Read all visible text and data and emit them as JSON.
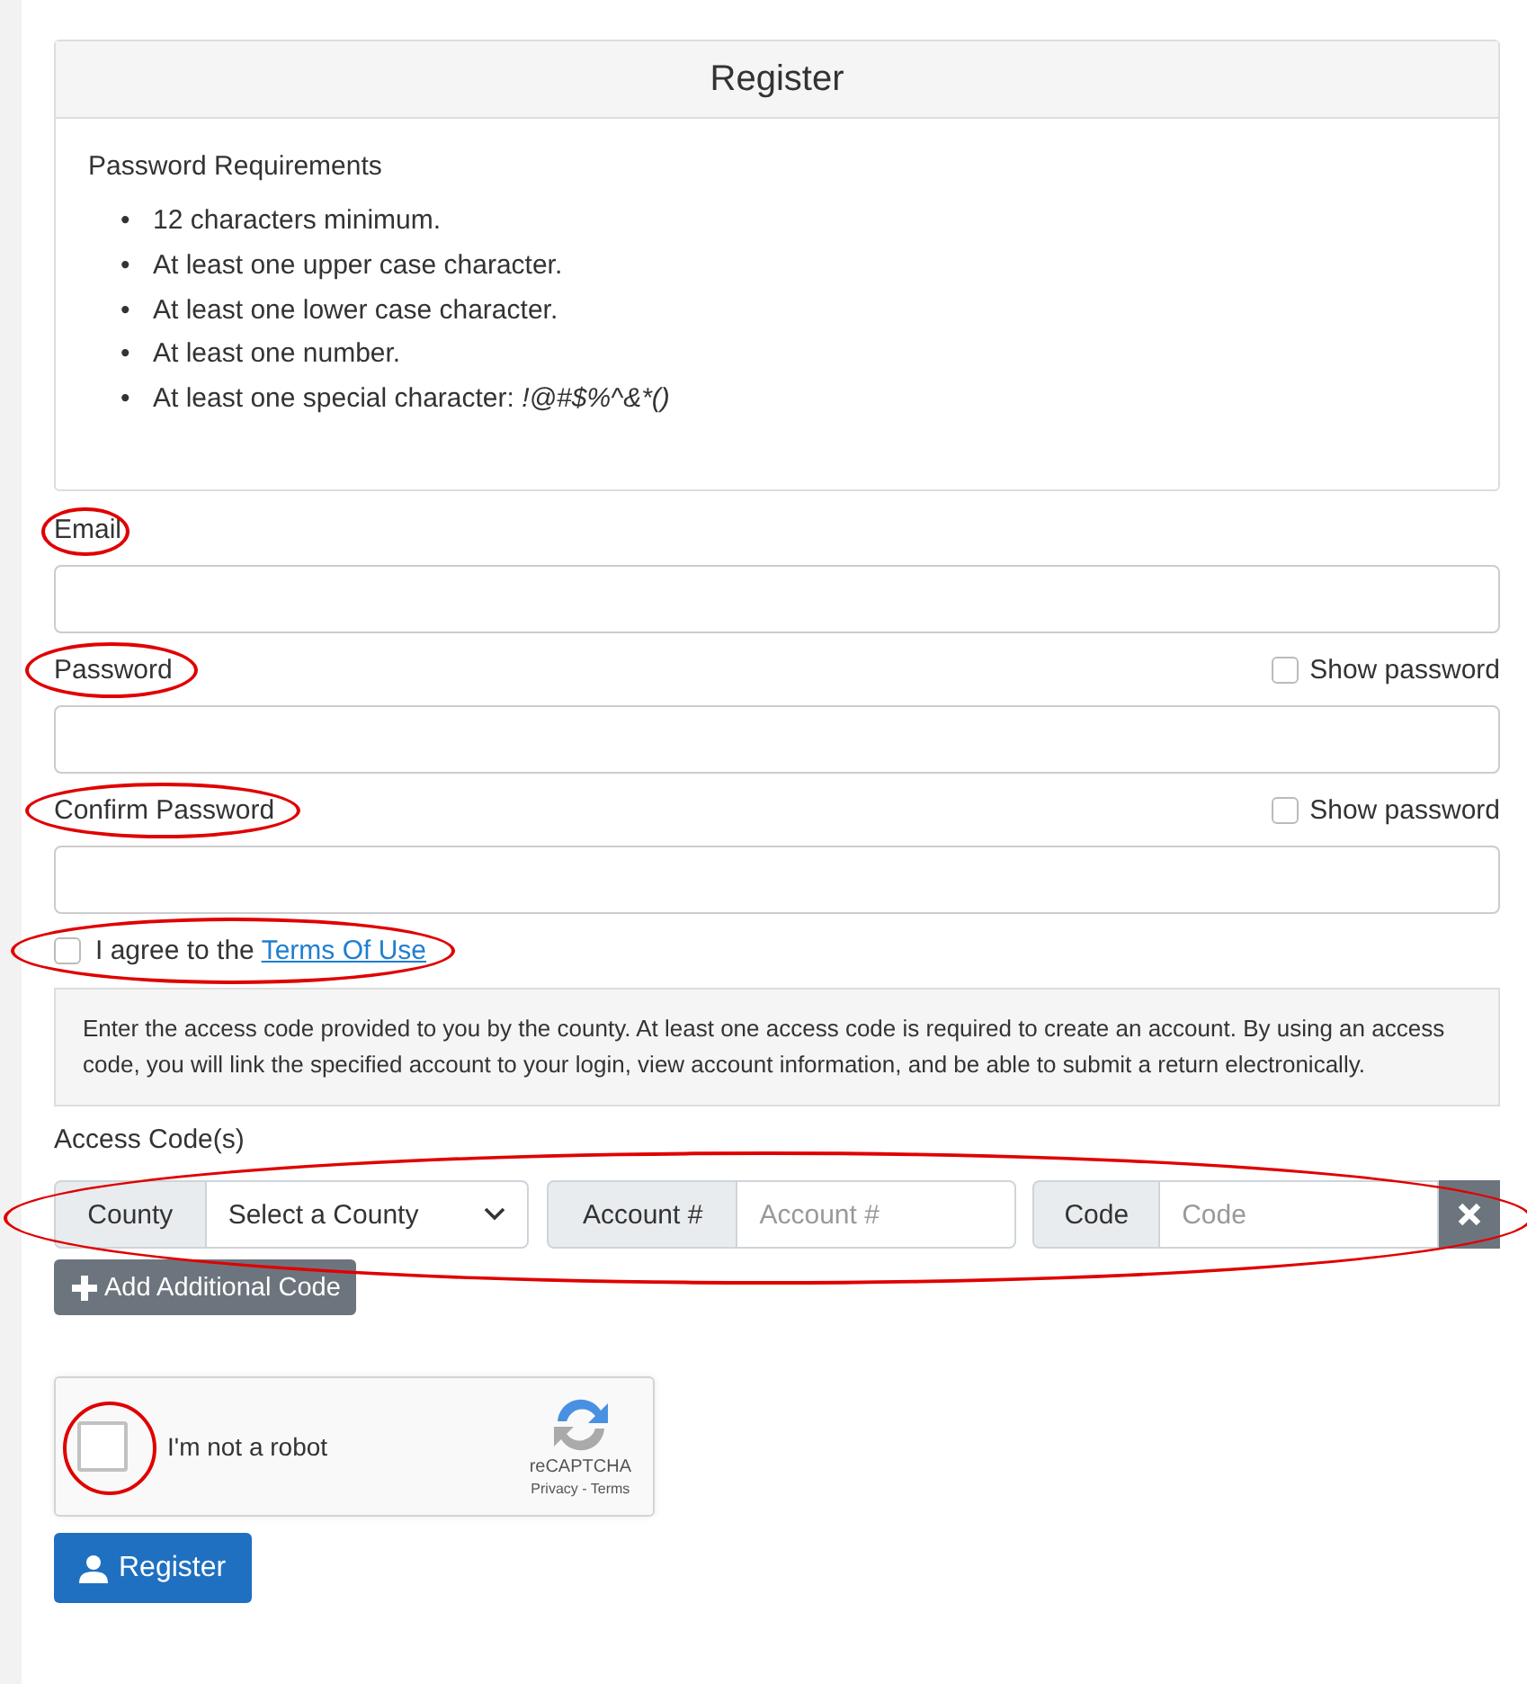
{
  "panel": {
    "title": "Register",
    "requirements_heading": "Password Requirements",
    "bullet": "•",
    "requirements": [
      {
        "text": "12 characters minimum."
      },
      {
        "text": "At least one upper case character."
      },
      {
        "text": "At least one lower case character."
      },
      {
        "text": "At least one number."
      },
      {
        "text": "At least one special character:",
        "example": "!@#$%^&*()"
      }
    ]
  },
  "email": {
    "label": "Email",
    "circled": true
  },
  "password": {
    "label": "Password",
    "circled": true,
    "show_label": "Show password",
    "show_checked": false
  },
  "confirm_password": {
    "label": "Confirm Password",
    "circled": true,
    "show_label": "Show password",
    "show_checked": false
  },
  "terms": {
    "prefix": "I agree to the",
    "link": "Terms Of Use",
    "checked": false,
    "circled": true
  },
  "info": "Enter the access code provided to you by the county. At least one access code is required to create an account. By using an access code, you will link the specified account to your login, view account information, and be able to submit a return electronically.",
  "access_codes": {
    "label": "Access Code(s)",
    "circled": true,
    "county_addon": "County",
    "county_select": "Select a County",
    "account_addon": "Account #",
    "account_placeholder": "Account #",
    "code_addon": "Code",
    "code_placeholder": "Code",
    "add_button": "Add Additional Code"
  },
  "captcha": {
    "label": "I'm not a robot",
    "checked": false,
    "circled": true,
    "brand": "reCAPTCHA",
    "links": "Privacy - Terms"
  },
  "submit": "Register"
}
